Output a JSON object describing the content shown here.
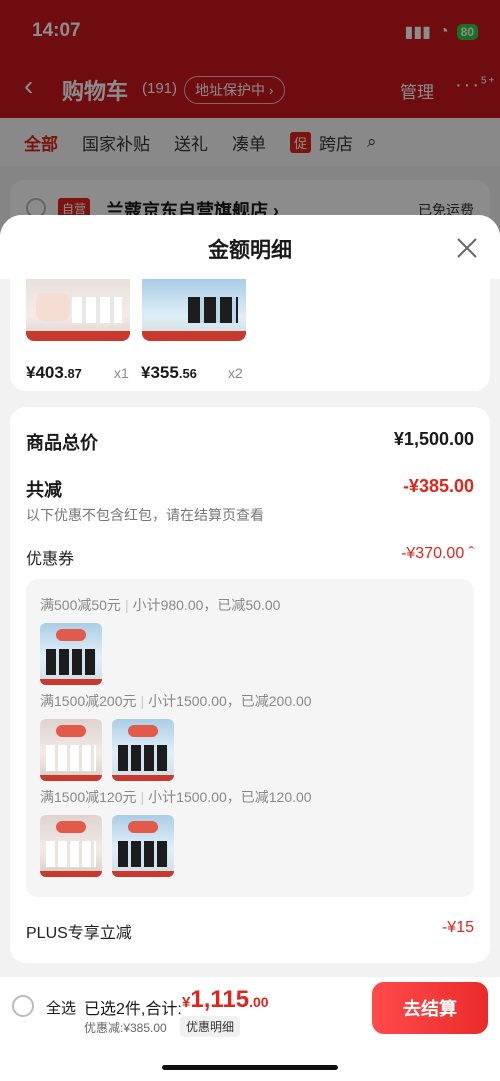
{
  "status_bar": {
    "time": "14:07",
    "battery": "80"
  },
  "nav": {
    "back": "‹",
    "title": "购物车",
    "count": "(191)",
    "address_badge": "地址保护中 ›",
    "manage": "管理",
    "more": "···",
    "more_badge": "5+"
  },
  "tabs": [
    "全部",
    "国家补贴",
    "送礼",
    "凑单",
    "跨店"
  ],
  "promo_tag": "促",
  "store": {
    "tag": "自营",
    "name": "兰蔻京东自营旗舰店 ›",
    "shipping": "已免运费"
  },
  "sheet": {
    "title": "金额明细",
    "products": [
      {
        "price_int": "¥403",
        "price_dec": ".87",
        "qty": "x1"
      },
      {
        "price_int": "¥355",
        "price_dec": ".56",
        "qty": "x2"
      }
    ],
    "total_label": "商品总价",
    "total_value": "¥1,500.00",
    "reduce_label": "共减",
    "reduce_value": "-¥385.00",
    "reduce_note": "以下优惠不包含红包，请在结算页查看",
    "coupon_label": "优惠券",
    "coupon_value": "-¥370.00 ˆ",
    "coupon_rules": [
      {
        "rule": "满500减50元",
        "detail": "小计980.00，已减50.00"
      },
      {
        "rule": "满1500减200元",
        "detail": "小计1500.00，已减200.00"
      },
      {
        "rule": "满1500减120元",
        "detail": "小计1500.00，已减120.00"
      }
    ],
    "plus_label": "PLUS专享立减",
    "plus_value": "-¥15"
  },
  "footer": {
    "select_all": "全选",
    "selected_summary": "已选2件,合计:",
    "total_yen": "¥",
    "total_int": "1,115",
    "total_dec": ".00",
    "discount": "优惠减:¥385.00",
    "detail_link": "优惠明细",
    "checkout": "去结算"
  }
}
